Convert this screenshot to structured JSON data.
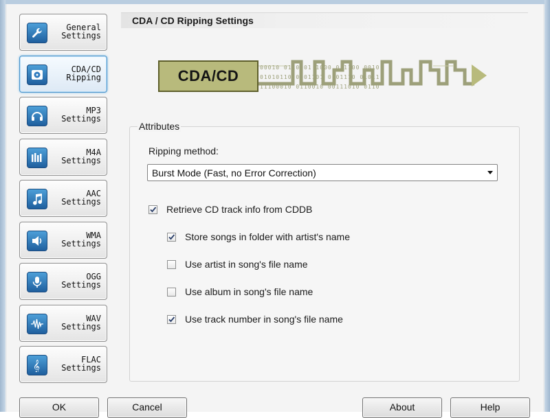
{
  "sidebar": {
    "items": [
      {
        "line1": "General",
        "line2": "Settings",
        "icon": "wrench-icon",
        "active": false
      },
      {
        "line1": "CDA/CD",
        "line2": "Ripping",
        "icon": "cd-drive-icon",
        "active": true
      },
      {
        "line1": "MP3",
        "line2": "Settings",
        "icon": "headphones-icon",
        "active": false
      },
      {
        "line1": "M4A",
        "line2": "Settings",
        "icon": "equalizer-icon",
        "active": false
      },
      {
        "line1": "AAC",
        "line2": "Settings",
        "icon": "music-note-icon",
        "active": false
      },
      {
        "line1": "WMA",
        "line2": "Settings",
        "icon": "speaker-icon",
        "active": false
      },
      {
        "line1": "OGG",
        "line2": "Settings",
        "icon": "microphone-icon",
        "active": false
      },
      {
        "line1": "WAV",
        "line2": "Settings",
        "icon": "waveform-icon",
        "active": false
      },
      {
        "line1": "FLAC",
        "line2": "Settings",
        "icon": "treble-clef-icon",
        "active": false
      }
    ]
  },
  "section": {
    "title": "CDA / CD Ripping Settings"
  },
  "banner": {
    "label": "CDA/CD",
    "bits_top": "00010 0110 01 1000 0 1100 0010",
    "bits_mid": "01010110 0101101 0101110 01011",
    "bits_bottom": "11100010 0110010 00111010 0110"
  },
  "attributes": {
    "legend": "Attributes",
    "ripping_method_label": "Ripping method:",
    "ripping_method_value": "Burst Mode (Fast, no Error Correction)",
    "checkboxes": [
      {
        "label": "Retrieve CD track info from CDDB",
        "checked": true
      },
      {
        "label": "Store songs in folder with artist's name",
        "checked": true
      },
      {
        "label": "Use artist in song's file name",
        "checked": false
      },
      {
        "label": "Use album in song's file name",
        "checked": false
      },
      {
        "label": "Use track number in song's file name",
        "checked": true
      }
    ]
  },
  "buttons": {
    "ok": "OK",
    "cancel": "Cancel",
    "about": "About",
    "help": "Help"
  },
  "colors": {
    "banner_fill": "#b8ba7c",
    "banner_line": "#9da07a",
    "active_border": "#4a93c9",
    "icon_blue": "#2f7bbf"
  }
}
